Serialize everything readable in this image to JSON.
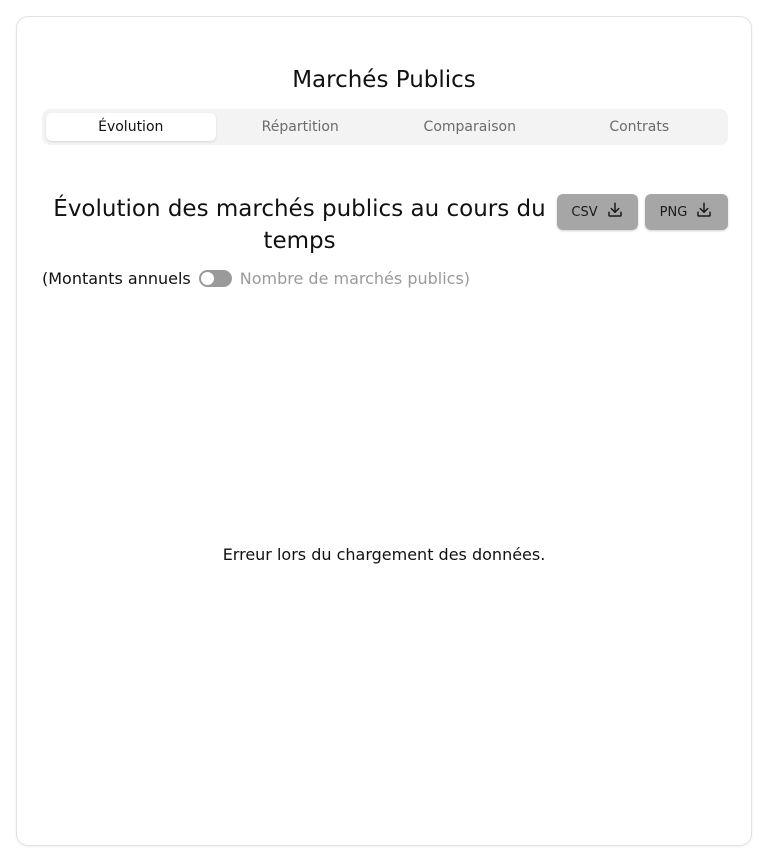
{
  "app": {
    "title": "Marchés Publics"
  },
  "tabs": [
    {
      "label": "Évolution",
      "active": true
    },
    {
      "label": "Répartition",
      "active": false
    },
    {
      "label": "Comparaison",
      "active": false
    },
    {
      "label": "Contrats",
      "active": false
    }
  ],
  "section": {
    "title": "Évolution des marchés publics au cours du temps",
    "buttons": {
      "csv_label": "CSV",
      "png_label": "PNG",
      "icon": "download-icon",
      "color": "#a6a6a6"
    }
  },
  "toggle": {
    "left_label": "(Montants annuels",
    "right_label": "Nombre de marchés publics)",
    "state": "off"
  },
  "status": {
    "error_message": "Erreur lors du chargement des données."
  }
}
